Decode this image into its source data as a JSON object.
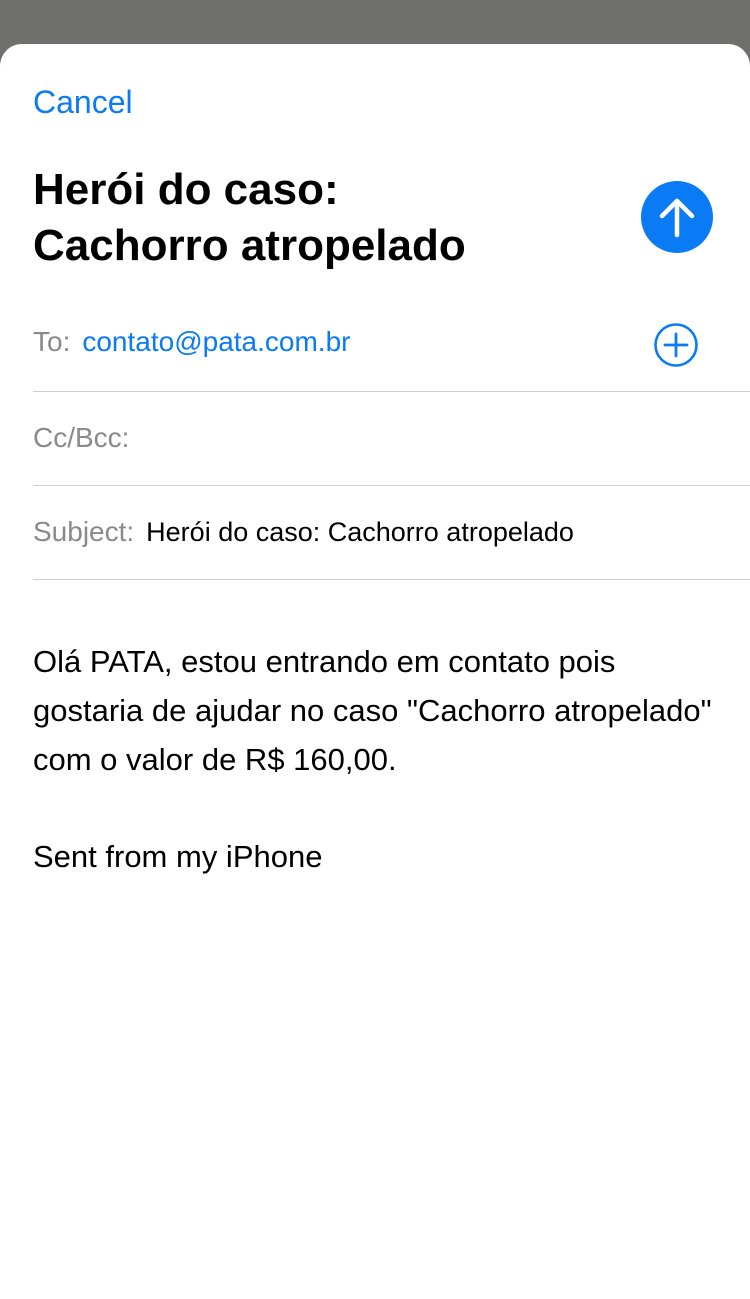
{
  "header": {
    "cancel_label": "Cancel",
    "title_line1": "Herói do caso:",
    "title_line2": "Cachorro atropelado"
  },
  "fields": {
    "to_label": "To:",
    "to_value": "contato@pata.com.br",
    "cc_label": "Cc/Bcc:",
    "cc_value": "",
    "subject_label": "Subject:",
    "subject_value": "Herói do caso: Cachorro atropelado"
  },
  "message": {
    "body": "Olá PATA, estou entrando em contato pois gostaria de ajudar no caso \"Cachorro atropelado\" com o valor de R$ 160,00.",
    "signature": "Sent from my iPhone"
  },
  "icons": {
    "send": "arrow-up-icon",
    "add_recipient": "plus-circle-icon"
  },
  "colors": {
    "accent": "#0a7bf5",
    "backdrop": "#6f706d",
    "label_gray": "#8a8a8e"
  }
}
